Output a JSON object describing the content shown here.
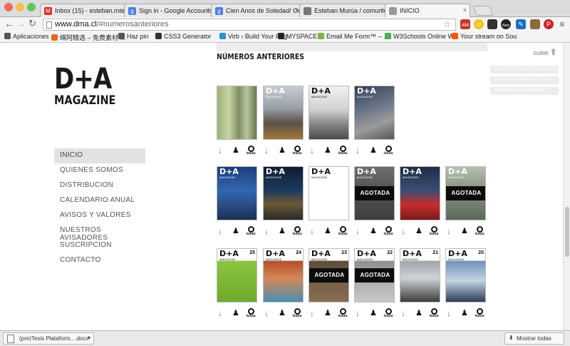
{
  "browser": {
    "tabs": [
      {
        "label": "Inbox (15) - esteban.murúa",
        "icon": "gmail-icon",
        "color": "#d93025"
      },
      {
        "label": "Sign in - Google Accounts",
        "icon": "google-icon",
        "color": "#4a7fe3"
      },
      {
        "label": "Cien Anos de Soledad/ On",
        "icon": "google-icon",
        "color": "#4a7fe3"
      },
      {
        "label": "Esteban Murúa / comunica",
        "icon": "page-icon",
        "color": "#777777"
      },
      {
        "label": "INICIO",
        "icon": "page-icon",
        "color": "#999999"
      }
    ],
    "url": "www.dma.cl/#numerosanteriores",
    "url_host": "www.dma.cl",
    "url_rest": "/#numerosanteriores",
    "extension_badges": {
      "mail": "484",
      "new": "New"
    },
    "bookmarks": [
      {
        "label": "Aplicaciones",
        "color": "#555555"
      },
      {
        "label": "绵阿精选 – 免费素材 …",
        "color": "#e46a1a"
      },
      {
        "label": "Haz pin",
        "color": "#555555"
      },
      {
        "label": "CSS3 Generator",
        "color": "#333333"
      },
      {
        "label": "Virb › Build Your Pag",
        "color": "#2b8fd6"
      },
      {
        "label": "MYSPACE",
        "color": "#222222"
      },
      {
        "label": "Email Me Form™ – …",
        "color": "#7cb342"
      },
      {
        "label": "W3Schools Online W",
        "color": "#4caf50"
      },
      {
        "label": "Your stream on Sou",
        "color": "#ff5500"
      }
    ]
  },
  "site": {
    "logo_top": "D+A",
    "logo_bottom": "MAGAZINE",
    "section_title": "NÚMEROS ANTERIORES",
    "subir": "SUBIR",
    "nav": [
      "INICIO",
      "QUIENES SOMOS",
      "DISTRIBUCION",
      "CALENDARIO ANUAL",
      "AVISOS Y VALORES",
      "NUESTROS AVISADORES",
      "SUSCRIPCION",
      "CONTACTO"
    ],
    "right_links": [
      "NÚMERO EN CIRCULACIÓN",
      "HOJEAR NÚMERO ACTUAL",
      "NÚMEROS ANTERIORES"
    ],
    "issuu_label": "issuu",
    "masthead": "D+A",
    "masthead_sub": "MAGAZINE",
    "agotada_label": "AGOTADA",
    "covers_row1": [
      {
        "masthead": false,
        "agotada": false,
        "bg": "linear-gradient(90deg,#9fb37a 0%,#c9d3a5 30%,#7e8f62 55%,#b8c59c 75%,#68774f 100%)"
      },
      {
        "masthead": true,
        "agotada": false,
        "bg": "linear-gradient(180deg,#c6cbd0 0%,#9aa2a9 40%,#5b5148 70%,#a0783c 100%)"
      },
      {
        "masthead": true,
        "dark": true,
        "agotada": false,
        "bg": "linear-gradient(180deg,#f2f2f2 0%,#d0d0d0 45%,#8a8a8a 70%,#4a4a4a 100%)"
      },
      {
        "masthead": true,
        "agotada": false,
        "bg": "linear-gradient(160deg,#2e3d56 0%,#6a7488 40%,#9b9b9b 70%,#565656 100%)"
      }
    ],
    "covers_row2": [
      {
        "masthead": true,
        "agotada": false,
        "bg": "linear-gradient(180deg,#1c3e7a 0%,#3267b0 45%,#2a4a80 75%,#1a2f55 100%)"
      },
      {
        "masthead": true,
        "agotada": false,
        "bg": "linear-gradient(180deg,#0f1d33 0%,#1d3a5e 45%,#6b5a35 70%,#2a2a2a 100%)"
      },
      {
        "masthead": true,
        "dark": true,
        "agotada": false,
        "bg": "#ffffff"
      },
      {
        "masthead": true,
        "agotada": true,
        "bg": "linear-gradient(180deg,#6f6f6f 0%,#555 40%,#3e3e3e 100%)"
      },
      {
        "masthead": true,
        "agotada": false,
        "bg": "linear-gradient(180deg,#1e2c48 0%,#3b4e74 45%,#c82b2b 72%,#7a1b1b 100%)"
      },
      {
        "masthead": true,
        "agotada": true,
        "bg": "linear-gradient(180deg,#b6bfb0 0%,#8a9784 40%,#5d6959 100%)"
      }
    ],
    "covers_row3": [
      {
        "masthead": true,
        "dark": true,
        "number": "25",
        "agotada": false,
        "bg": "linear-gradient(180deg,#ffffff 0%,#ffffff 22%,#8bc540 22%,#6fa92c 100%)"
      },
      {
        "masthead": true,
        "dark": true,
        "number": "24",
        "agotada": false,
        "bg": "linear-gradient(180deg,#ffffff 0%,#ffffff 22%,#b34d2a 22%,#d48654 55%,#4a8fb0 100%)"
      },
      {
        "masthead": true,
        "dark": true,
        "number": "23",
        "agotada": true,
        "bg": "linear-gradient(180deg,#ffffff 0%,#ffffff 22%,#5d4c3a 22%,#8a6e52 100%)"
      },
      {
        "masthead": true,
        "dark": true,
        "number": "22",
        "agotada": true,
        "bg": "linear-gradient(180deg,#ffffff 0%,#ffffff 22%,#8f8f8f 22%,#c9c9c9 100%)"
      },
      {
        "masthead": true,
        "dark": true,
        "number": "21",
        "agotada": false,
        "bg": "linear-gradient(180deg,#ffffff 0%,#ffffff 22%,#9ea3a8 22%,#d0d3d6 55%,#3d3d3d 100%)"
      },
      {
        "masthead": true,
        "dark": true,
        "number": "20",
        "agotada": false,
        "bg": "linear-gradient(180deg,#ffffff 0%,#ffffff 22%,#6e8fb8 22%,#c5d3e4 60%,#2b3e58 100%)"
      }
    ]
  },
  "downloads": {
    "file": "(pre)Tesis Plataform....docx",
    "show_all": "Mostrar todas"
  }
}
